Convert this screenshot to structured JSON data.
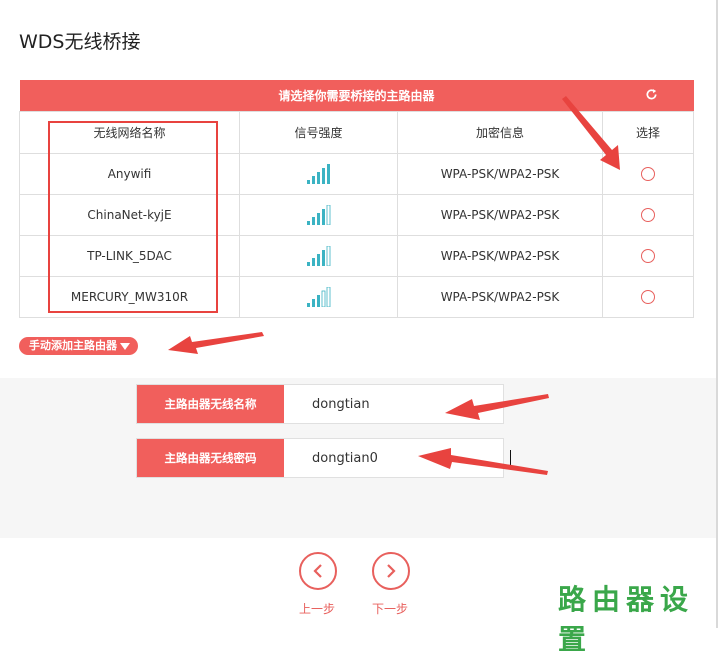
{
  "page": {
    "title": "WDS无线桥接"
  },
  "table": {
    "header_title": "请选择你需要桥接的主路由器",
    "columns": [
      "无线网络名称",
      "信号强度",
      "加密信息",
      "选择"
    ],
    "rows": [
      {
        "ssid": "Anywifi",
        "signal_bars": 5,
        "signal_level": 1.0,
        "encryption": "WPA-PSK/WPA2-PSK"
      },
      {
        "ssid": "ChinaNet-kyjE",
        "signal_bars": 5,
        "signal_level": 0.8,
        "encryption": "WPA-PSK/WPA2-PSK"
      },
      {
        "ssid": "TP-LINK_5DAC",
        "signal_bars": 5,
        "signal_level": 0.8,
        "encryption": "WPA-PSK/WPA2-PSK"
      },
      {
        "ssid": "MERCURY_MW310R",
        "signal_bars": 5,
        "signal_level": 0.6,
        "encryption": "WPA-PSK/WPA2-PSK"
      }
    ],
    "refresh_icon": "refresh-icon"
  },
  "manual_add": {
    "label": "手动添加主路由器"
  },
  "form": {
    "ssid_label": "主路由器无线名称",
    "ssid_value": "dongtian",
    "password_label": "主路由器无线密码",
    "password_value": "dongtian0"
  },
  "nav": {
    "prev_label": "上一步",
    "next_label": "下一步"
  },
  "watermark": {
    "text": "路由器设置"
  },
  "colors": {
    "accent": "#f15f5c",
    "annotation_red": "#e8433f",
    "signal_teal": "#3bb3c3",
    "watermark_green": "#3aa74a"
  }
}
